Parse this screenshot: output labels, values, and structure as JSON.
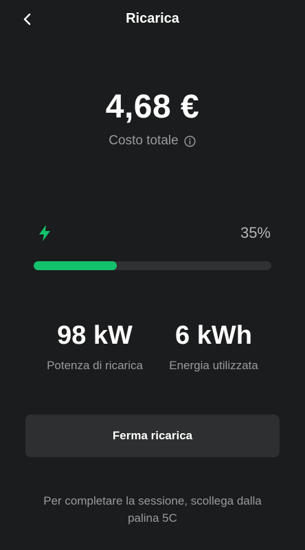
{
  "header": {
    "title": "Ricarica",
    "back_icon": "chevron-left-icon"
  },
  "cost": {
    "amount": "4,68 €",
    "label": "Costo totale",
    "info_icon": "info-icon"
  },
  "charging": {
    "bolt_icon": "lightning-bolt-icon",
    "percent_text": "35%",
    "progress_fraction": 0.35,
    "accent_color": "#14c16c"
  },
  "stats": {
    "power_value": "98 kW",
    "power_label": "Potenza di ricarica",
    "energy_value": "6 kWh",
    "energy_label": "Energia utilizzata"
  },
  "actions": {
    "stop_label": "Ferma ricarica"
  },
  "footer": {
    "hint": "Per completare la sessione, scollega dalla palina 5C"
  }
}
